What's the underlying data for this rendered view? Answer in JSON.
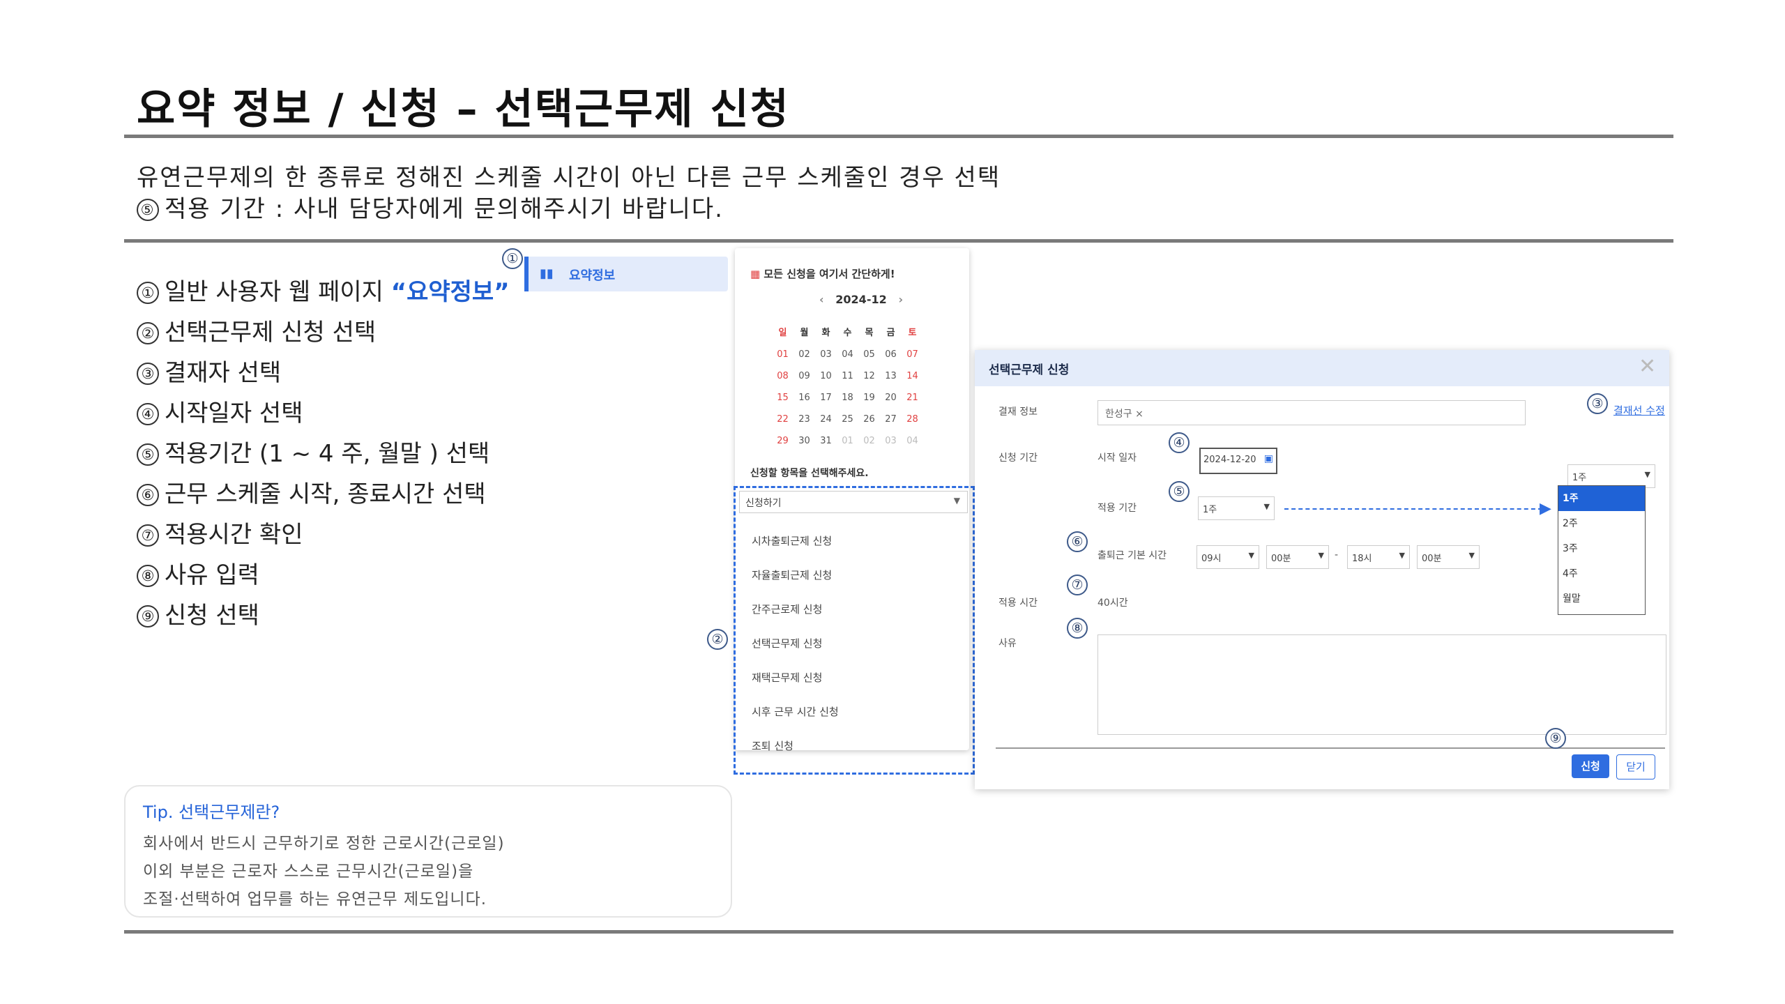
{
  "page": {
    "title": "요약 정보 / 신청 – 선택근무제 신청",
    "intro_lines": [
      "유연근무제의 한 종류로 정해진 스케줄 시간이 아닌 다른 근무 스케줄인 경우 선택",
      "적용 기간 : 사내 담당자에게 문의해주시기 바랍니다."
    ],
    "intro_marker": "⑤"
  },
  "steps": [
    {
      "num": "①",
      "text": "일반 사용자 웹 페이지 ",
      "highlight": "“요약정보”"
    },
    {
      "num": "②",
      "text": "선택근무제 신청 선택"
    },
    {
      "num": "③",
      "text": "결재자 선택"
    },
    {
      "num": "④",
      "text": "시작일자 선택"
    },
    {
      "num": "⑤",
      "text": "적용기간 (1 ~ 4 주, 월말 ) 선택"
    },
    {
      "num": "⑥",
      "text": "근무 스케줄 시작, 종료시간 선택"
    },
    {
      "num": "⑦",
      "text": "적용시간 확인"
    },
    {
      "num": "⑧",
      "text": "사유 입력"
    },
    {
      "num": "⑨",
      "text": "신청 선택"
    }
  ],
  "tip": {
    "title": "Tip. 선택근무제란?",
    "lines": [
      "회사에서 반드시 근무하기로 정한 근로시간(근로일)",
      "이외 부분은 근로자 스스로 근무시간(근로일)을",
      "조절·선택하여 업무를 하는 유연근무 제도입니다."
    ]
  },
  "sidebar": {
    "item_label": "요약정보",
    "icon": "bar-chart-icon"
  },
  "calendar": {
    "header": "모든 신청을 여기서 간단하게!",
    "month": "2024-12",
    "weekdays": [
      "일",
      "월",
      "화",
      "수",
      "목",
      "금",
      "토"
    ],
    "weeks": [
      [
        "01",
        "02",
        "03",
        "04",
        "05",
        "06",
        "07"
      ],
      [
        "08",
        "09",
        "10",
        "11",
        "12",
        "13",
        "14"
      ],
      [
        "15",
        "16",
        "17",
        "18",
        "19",
        "20",
        "21"
      ],
      [
        "22",
        "23",
        "24",
        "25",
        "26",
        "27",
        "28"
      ],
      [
        "29",
        "30",
        "31",
        "01",
        "02",
        "03",
        "04"
      ]
    ],
    "prompt": "신청할 항목을 선택해주세요.",
    "select_label": "신청하기",
    "options": [
      "시차출퇴근제 신청",
      "자율출퇴근제 신청",
      "간주근로제 신청",
      "선택근무제 신청",
      "재택근무제 신청",
      "시후 근무 시간 신청",
      "조퇴 신청"
    ]
  },
  "modal": {
    "title": "선택근무제 신청",
    "approval_label": "결재 정보",
    "approver_chip": "한성구 ×",
    "approver_link": "결재선 수정",
    "period_label": "신청 기간",
    "start_label": "시작 일자",
    "start_value": "2024-12-20",
    "apply_label": "적용 기간",
    "apply_value": "1주",
    "schedule_label": "출퇴근 기본 시간",
    "start_hour": "09시",
    "start_min": "00분",
    "dash": "-",
    "end_hour": "18시",
    "end_min": "00분",
    "hours_label": "적용 시간",
    "hours_value": "40시간",
    "reason_label": "사유",
    "apply_button": "신청",
    "close_button": "닫기",
    "period_select_value": "1주",
    "period_options": [
      "1주",
      "2주",
      "3주",
      "4주",
      "월말"
    ]
  },
  "markers": [
    "①",
    "②",
    "③",
    "④",
    "⑤",
    "⑥",
    "⑦",
    "⑧",
    "⑨"
  ],
  "colors": {
    "accent": "#2f6de0",
    "highlight": "#1f5fd1",
    "sunday_red": "#e04040"
  }
}
